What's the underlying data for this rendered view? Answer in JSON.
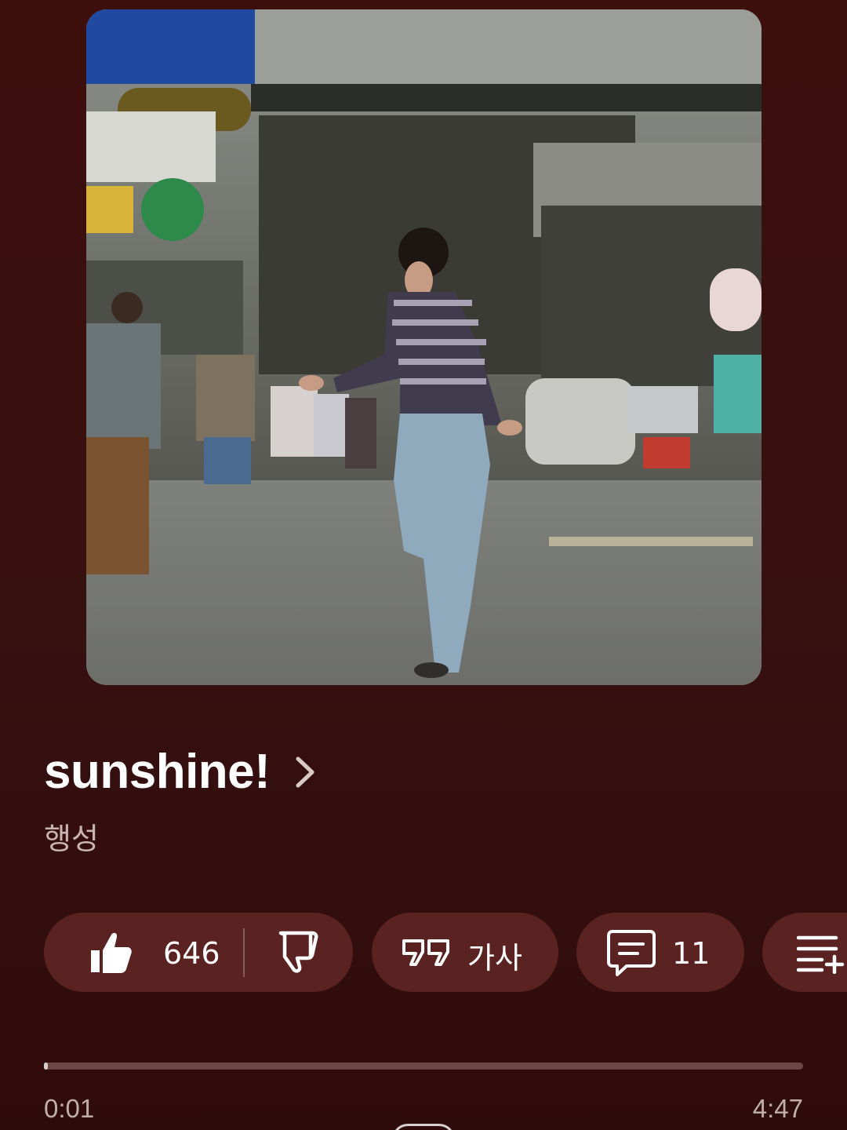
{
  "track": {
    "title": "sunshine!",
    "artist": "행성"
  },
  "actions": {
    "like_count": "646",
    "lyrics_label": "가사",
    "comments_count": "11"
  },
  "icons": {
    "like": "thumbs-up-icon",
    "dislike": "thumbs-down-icon",
    "lyrics": "quote-icon",
    "comments": "comment-icon",
    "save": "playlist-add-icon",
    "title_chevron": "chevron-right-icon"
  },
  "playback": {
    "current_time": "0:01",
    "total_time": "4:47",
    "progress_fraction": 0.004
  },
  "colors": {
    "background": "#3a0e0c",
    "pill_background": "#5a2322",
    "progress_track": "#6b4645",
    "progress_fill": "#d9cfcf",
    "secondary_text": "#c8b4b2"
  }
}
